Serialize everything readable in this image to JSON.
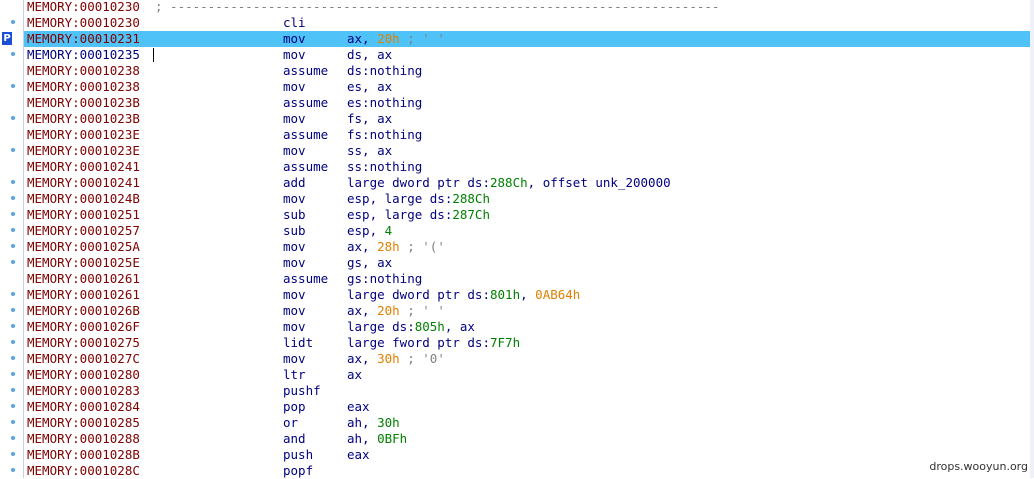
{
  "separator_comment": "; -------------------------------------------------------------------------",
  "watermark": "drops.wooyun.org",
  "colors": {
    "address": "#800000",
    "address_current": "#000080",
    "mnemonic": "#000080",
    "number": "#008000",
    "immediate": "#e08000",
    "comment": "#808080",
    "selection": "#4fc3f7"
  },
  "rows": [
    {
      "addr": "MEMORY:00010230",
      "mn": "",
      "ops": [],
      "sep": true,
      "dot": false
    },
    {
      "addr": "MEMORY:00010230",
      "mn": "cli",
      "ops": [],
      "dot": true
    },
    {
      "addr": "MEMORY:00010231",
      "mn": "mov",
      "ops": [
        [
          "ax, ",
          ""
        ],
        [
          "20h",
          "numimm"
        ],
        [
          " ; ' '",
          "cmt"
        ]
      ],
      "dot": true,
      "selected": true,
      "marker": "P"
    },
    {
      "addr": "MEMORY:00010235",
      "mn": "mov",
      "ops": [
        [
          "ds, ax",
          ""
        ]
      ],
      "dot": true,
      "current": true
    },
    {
      "addr": "MEMORY:00010238",
      "mn": "assume",
      "ops": [
        [
          "ds:nothing",
          ""
        ]
      ],
      "dot": false
    },
    {
      "addr": "MEMORY:00010238",
      "mn": "mov",
      "ops": [
        [
          "es, ax",
          ""
        ]
      ],
      "dot": true
    },
    {
      "addr": "MEMORY:0001023B",
      "mn": "assume",
      "ops": [
        [
          "es:nothing",
          ""
        ]
      ],
      "dot": false
    },
    {
      "addr": "MEMORY:0001023B",
      "mn": "mov",
      "ops": [
        [
          "fs, ax",
          ""
        ]
      ],
      "dot": true
    },
    {
      "addr": "MEMORY:0001023E",
      "mn": "assume",
      "ops": [
        [
          "fs:nothing",
          ""
        ]
      ],
      "dot": false
    },
    {
      "addr": "MEMORY:0001023E",
      "mn": "mov",
      "ops": [
        [
          "ss, ax",
          ""
        ]
      ],
      "dot": true
    },
    {
      "addr": "MEMORY:00010241",
      "mn": "assume",
      "ops": [
        [
          "ss:nothing",
          ""
        ]
      ],
      "dot": false
    },
    {
      "addr": "MEMORY:00010241",
      "mn": "add",
      "ops": [
        [
          "large dword ptr ds:",
          ""
        ],
        [
          "288Ch",
          "num"
        ],
        [
          ", offset unk_200000",
          ""
        ]
      ],
      "dot": true
    },
    {
      "addr": "MEMORY:0001024B",
      "mn": "mov",
      "ops": [
        [
          "esp, large ds:",
          ""
        ],
        [
          "288Ch",
          "num"
        ]
      ],
      "dot": true
    },
    {
      "addr": "MEMORY:00010251",
      "mn": "sub",
      "ops": [
        [
          "esp, large ds:",
          ""
        ],
        [
          "287Ch",
          "num"
        ]
      ],
      "dot": true
    },
    {
      "addr": "MEMORY:00010257",
      "mn": "sub",
      "ops": [
        [
          "esp, ",
          ""
        ],
        [
          "4",
          "num"
        ]
      ],
      "dot": true
    },
    {
      "addr": "MEMORY:0001025A",
      "mn": "mov",
      "ops": [
        [
          "ax, ",
          ""
        ],
        [
          "28h",
          "numimm"
        ],
        [
          " ; '('",
          "cmt"
        ]
      ],
      "dot": true
    },
    {
      "addr": "MEMORY:0001025E",
      "mn": "mov",
      "ops": [
        [
          "gs, ax",
          ""
        ]
      ],
      "dot": true
    },
    {
      "addr": "MEMORY:00010261",
      "mn": "assume",
      "ops": [
        [
          "gs:nothing",
          ""
        ]
      ],
      "dot": false
    },
    {
      "addr": "MEMORY:00010261",
      "mn": "mov",
      "ops": [
        [
          "large dword ptr ds:",
          ""
        ],
        [
          "801h",
          "num"
        ],
        [
          ", ",
          ""
        ],
        [
          "0AB64h",
          "numimm"
        ]
      ],
      "dot": true
    },
    {
      "addr": "MEMORY:0001026B",
      "mn": "mov",
      "ops": [
        [
          "ax, ",
          ""
        ],
        [
          "20h",
          "numimm"
        ],
        [
          " ; ' '",
          "cmt"
        ]
      ],
      "dot": true
    },
    {
      "addr": "MEMORY:0001026F",
      "mn": "mov",
      "ops": [
        [
          "large ds:",
          ""
        ],
        [
          "805h",
          "num"
        ],
        [
          ", ax",
          ""
        ]
      ],
      "dot": true
    },
    {
      "addr": "MEMORY:00010275",
      "mn": "lidt",
      "ops": [
        [
          "large fword ptr ds:",
          ""
        ],
        [
          "7F7h",
          "num"
        ]
      ],
      "dot": true
    },
    {
      "addr": "MEMORY:0001027C",
      "mn": "mov",
      "ops": [
        [
          "ax, ",
          ""
        ],
        [
          "30h",
          "numimm"
        ],
        [
          " ; '0'",
          "cmt"
        ]
      ],
      "dot": true
    },
    {
      "addr": "MEMORY:00010280",
      "mn": "ltr",
      "ops": [
        [
          "ax",
          ""
        ]
      ],
      "dot": true
    },
    {
      "addr": "MEMORY:00010283",
      "mn": "pushf",
      "ops": [],
      "dot": true
    },
    {
      "addr": "MEMORY:00010284",
      "mn": "pop",
      "ops": [
        [
          "eax",
          ""
        ]
      ],
      "dot": true
    },
    {
      "addr": "MEMORY:00010285",
      "mn": "or",
      "ops": [
        [
          "ah, ",
          ""
        ],
        [
          "30h",
          "num"
        ]
      ],
      "dot": true
    },
    {
      "addr": "MEMORY:00010288",
      "mn": "and",
      "ops": [
        [
          "ah, ",
          ""
        ],
        [
          "0BFh",
          "num"
        ]
      ],
      "dot": true
    },
    {
      "addr": "MEMORY:0001028B",
      "mn": "push",
      "ops": [
        [
          "eax",
          ""
        ]
      ],
      "dot": true
    },
    {
      "addr": "MEMORY:0001028C",
      "mn": "popf",
      "ops": [],
      "dot": true
    }
  ]
}
